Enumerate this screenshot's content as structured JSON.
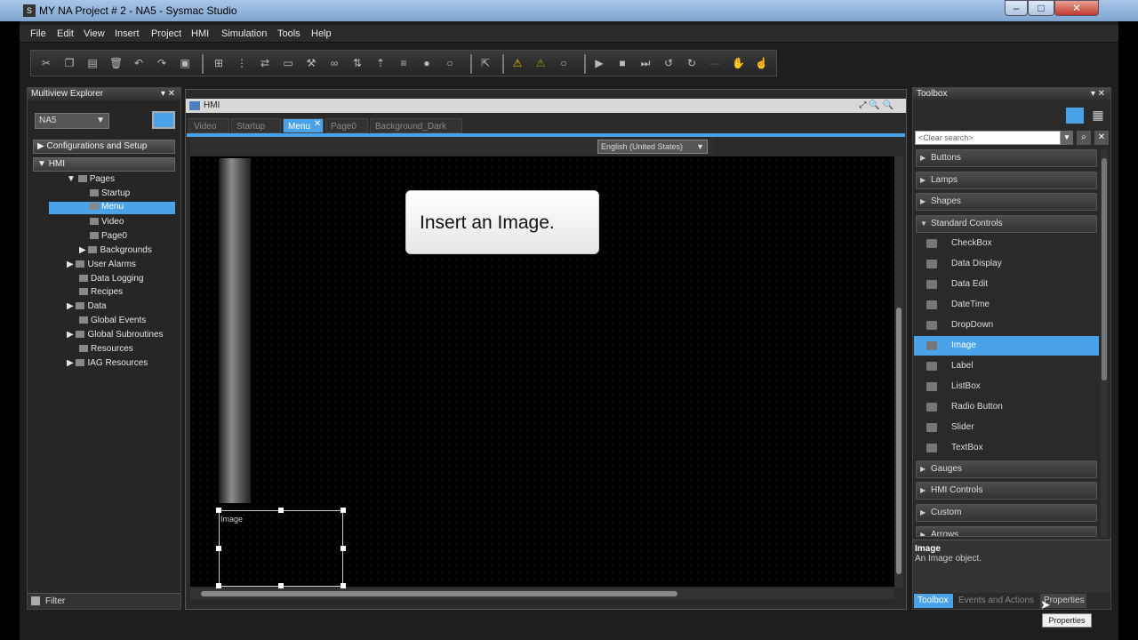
{
  "window": {
    "title": "MY NA Project # 2 - NA5 - Sysmac Studio",
    "app_icon": "S"
  },
  "menu": [
    "File",
    "Edit",
    "View",
    "Insert",
    "Project",
    "HMI",
    "Simulation",
    "Tools",
    "Help"
  ],
  "explorer": {
    "title": "Multiview Explorer",
    "device": "NA5",
    "config_button": "Configurations and Setup",
    "hmi_button": "HMI",
    "tree": [
      "Pages",
      "Startup",
      "Menu",
      "Video",
      "Page0",
      "Backgrounds",
      "User Alarms",
      "Data Logging",
      "Recipes",
      "Data",
      "Global Events",
      "Global Subroutines",
      "Resources",
      "IAG Resources"
    ],
    "filter": "Filter"
  },
  "editor": {
    "title": "HMI",
    "tabs": [
      "Video",
      "Startup",
      "Menu",
      "Page0",
      "Background_Dark"
    ],
    "language": "English (United States)",
    "callout": "Insert an Image.",
    "image_label": "Image"
  },
  "toolbox": {
    "title": "Toolbox",
    "search_placeholder": "<Clear search>",
    "categories_top": [
      "Buttons",
      "Lamps",
      "Shapes",
      "Standard Controls"
    ],
    "items": [
      "CheckBox",
      "Data Display",
      "Data Edit",
      "DateTime",
      "DropDown",
      "Image",
      "Label",
      "ListBox",
      "Radio Button",
      "Slider",
      "TextBox"
    ],
    "categories_bottom": [
      "Gauges",
      "HMI Controls",
      "Custom",
      "Arrows"
    ],
    "desc_title": "Image",
    "desc_text": "An Image object.",
    "bottom_tabs": [
      "Toolbox",
      "Events and Actions",
      "Properties"
    ],
    "tooltip": "Properties"
  },
  "colors": {
    "accent": "#4aa3e8",
    "background": "#000000"
  }
}
